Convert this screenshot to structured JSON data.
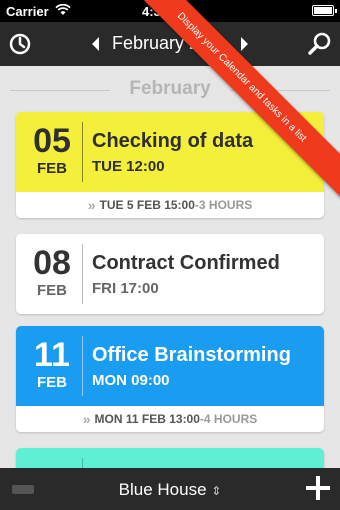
{
  "status_bar": {
    "carrier": "Carrier",
    "time": "4:3",
    "wifi_icon": "wifi-icon",
    "battery_icon": "battery-icon"
  },
  "nav": {
    "title": "February 2",
    "left_icon": "clock-icon",
    "right_icon": "search-icon",
    "prev_icon": "chevron-left-icon",
    "next_icon": "chevron-right-icon"
  },
  "ribbon": {
    "text": "Display your Calendar and tasks in a list",
    "color": "#f03a1e"
  },
  "section": {
    "label": "February"
  },
  "events": [
    {
      "day": "05",
      "month": "FEB",
      "title": "Checking of data",
      "time": "TUE 12:00",
      "footer_date": "TUE 5 FEB 15:00",
      "footer_duration": "-3 HOURS",
      "color": "#f3ef3a"
    },
    {
      "day": "08",
      "month": "FEB",
      "title": "Contract Confirmed",
      "time": "FRI 17:00",
      "color": "#ffffff"
    },
    {
      "day": "11",
      "month": "FEB",
      "title": "Office Brainstorming",
      "time": "MON 09:00",
      "footer_date": "MON 11 FEB 13:00",
      "footer_duration": "-4 HOURS",
      "color": "#1a9cf1"
    },
    {
      "color": "#5ef0d5"
    }
  ],
  "bottom_bar": {
    "calendar_name": "Blue House",
    "calendar_arrows": "⇕",
    "left_icon": "battery-icon",
    "add_icon": "plus-icon"
  }
}
